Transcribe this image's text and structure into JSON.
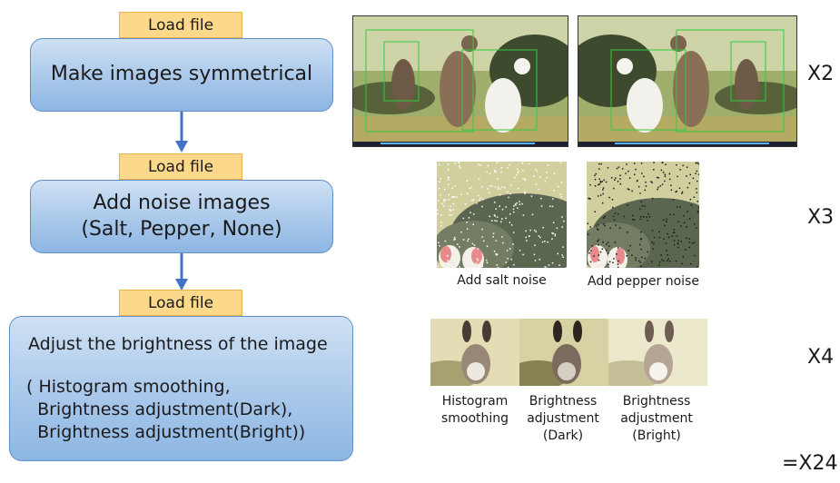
{
  "steps": [
    {
      "tag": "Load file",
      "lines": [
        "Make images symmetrical"
      ],
      "multiplier": "X2"
    },
    {
      "tag": "Load file",
      "lines": [
        "Add noise images",
        "(Salt, Pepper, None)"
      ],
      "multiplier": "X3",
      "captions": [
        "Add salt noise",
        "Add pepper noise"
      ]
    },
    {
      "tag": "Load file",
      "lines": [
        "Adjust the brightness of the image",
        "",
        "( Histogram smoothing,",
        "  Brightness adjustment(Dark),",
        "  Brightness adjustment(Bright))"
      ],
      "multiplier": "X4",
      "captions": [
        [
          "Histogram",
          "smoothing"
        ],
        [
          "Brightness",
          "adjustment",
          "(Dark)"
        ],
        [
          "Brightness",
          "adjustment",
          "(Bright)"
        ]
      ]
    }
  ],
  "total": "=X24",
  "colors": {
    "tag_fill": "#fcd88a",
    "box_fill": "#a9c8ea",
    "arrow": "#4472c4"
  }
}
